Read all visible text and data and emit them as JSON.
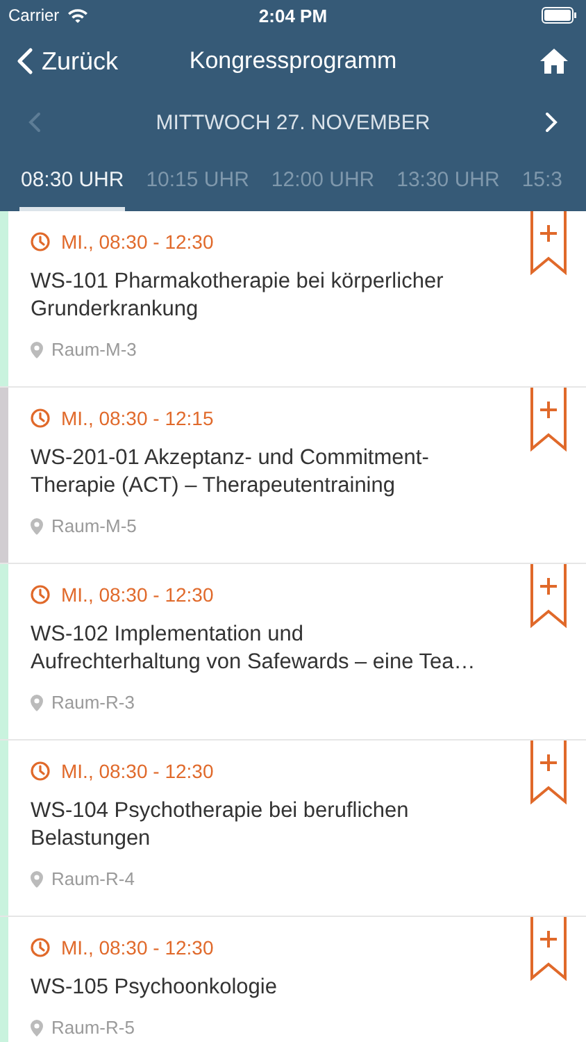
{
  "status_bar": {
    "carrier": "Carrier",
    "time": "2:04 PM"
  },
  "nav": {
    "back": "Zurück",
    "title": "Kongressprogramm"
  },
  "date_bar": {
    "label": "MITTWOCH 27. NOVEMBER",
    "prev_disabled": true,
    "next_disabled": false
  },
  "tabs": [
    {
      "label": "08:30 UHR",
      "selected": true
    },
    {
      "label": "10:15 UHR",
      "selected": false
    },
    {
      "label": "12:00 UHR",
      "selected": false
    },
    {
      "label": "13:30 UHR",
      "selected": false
    },
    {
      "label": "15:3",
      "selected": false
    }
  ],
  "sessions": [
    {
      "time": "MI., 08:30 - 12:30",
      "title": "WS-101 Pharmakotherapie bei körperlicher Grunderkrankung",
      "room": "Raum-M-3",
      "color": "#c9f3de"
    },
    {
      "time": "MI., 08:30 - 12:15",
      "title": "WS-201-01 Akzeptanz- und Commitment-Therapie (ACT) – Therapeutentraining",
      "room": "Raum-M-5",
      "color": "#d1cdd1"
    },
    {
      "time": "MI., 08:30 - 12:30",
      "title": "WS-102 Implementation und Aufrechterhaltung von Safewards – eine Tea…",
      "room": "Raum-R-3",
      "color": "#c9f3de"
    },
    {
      "time": "MI., 08:30 - 12:30",
      "title": "WS-104 Psychotherapie bei beruflichen Belastungen",
      "room": "Raum-R-4",
      "color": "#c9f3de"
    },
    {
      "time": "MI., 08:30 - 12:30",
      "title": "WS-105 Psychoonkologie",
      "room": "Raum-R-5",
      "color": "#c9f3de"
    }
  ]
}
